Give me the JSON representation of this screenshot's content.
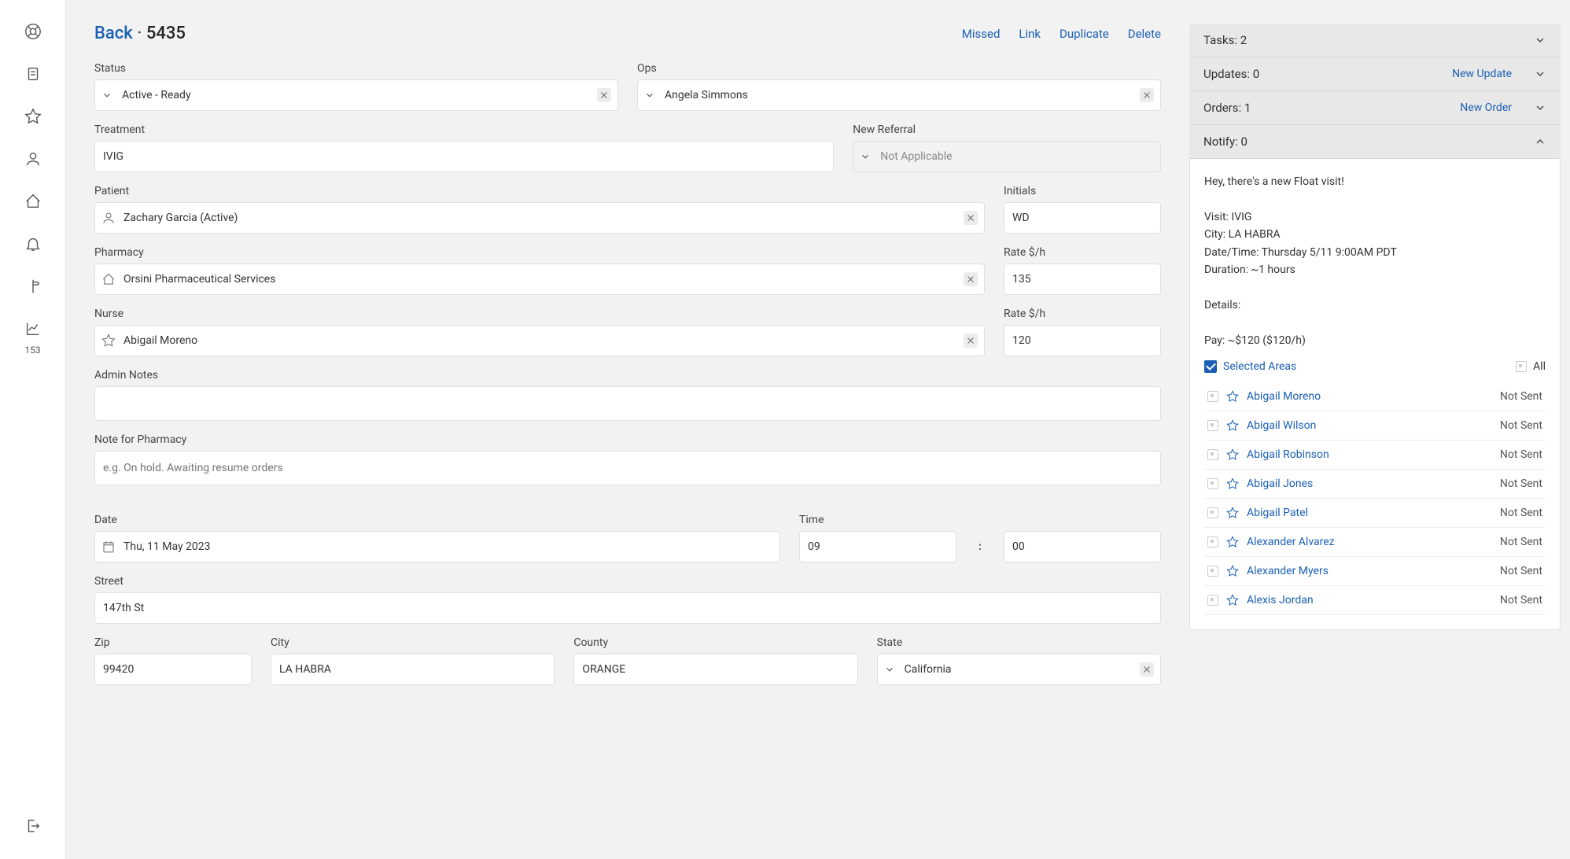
{
  "breadcrumb": {
    "back": "Back",
    "id": "5435"
  },
  "header_actions": {
    "missed": "Missed",
    "link": "Link",
    "duplicate": "Duplicate",
    "delete": "Delete"
  },
  "sidebar": {
    "badge": "153"
  },
  "labels": {
    "status": "Status",
    "ops": "Ops",
    "treatment": "Treatment",
    "new_referral": "New Referral",
    "patient": "Patient",
    "initials": "Initials",
    "pharmacy": "Pharmacy",
    "rate": "Rate $/h",
    "nurse": "Nurse",
    "admin_notes": "Admin Notes",
    "note_pharmacy": "Note for Pharmacy",
    "date": "Date",
    "time": "Time",
    "street": "Street",
    "zip": "Zip",
    "city": "City",
    "county": "County",
    "state": "State"
  },
  "values": {
    "status": "Active - Ready",
    "ops": "Angela Simmons",
    "treatment": "IVIG",
    "new_referral": "Not Applicable",
    "patient": "Zachary Garcia (Active)",
    "initials": "WD",
    "pharmacy": "Orsini Pharmaceutical Services",
    "pharmacy_rate": "135",
    "nurse": "Abigail Moreno",
    "nurse_rate": "120",
    "admin_notes": "",
    "note_pharmacy_placeholder": "e.g. On hold. Awaiting resume orders",
    "date": "Thu, 11 May 2023",
    "time_h": "09",
    "time_m": "00",
    "street": "147th St",
    "zip": "99420",
    "city": "LA HABRA",
    "county": "ORANGE",
    "state": "California"
  },
  "panel": {
    "tasks": "Tasks: 2",
    "updates": "Updates: 0",
    "new_update": "New Update",
    "orders": "Orders: 1",
    "new_order": "New Order",
    "notify": "Notify: 0"
  },
  "notify_message": "Hey, there's a new Float visit!\n\nVisit: IVIG\nCity: LA HABRA\nDate/Time: Thursday 5/11 9:00AM PDT\nDuration: ~1 hours\n\nDetails:\n\nPay: ~$120 ($120/h)",
  "filters": {
    "selected": "Selected Areas",
    "all": "All"
  },
  "nurses": [
    {
      "name": "Abigail Moreno",
      "status": "Not Sent"
    },
    {
      "name": "Abigail Wilson",
      "status": "Not Sent"
    },
    {
      "name": "Abigail Robinson",
      "status": "Not Sent"
    },
    {
      "name": "Abigail Jones",
      "status": "Not Sent"
    },
    {
      "name": "Abigail Patel",
      "status": "Not Sent"
    },
    {
      "name": "Alexander Alvarez",
      "status": "Not Sent"
    },
    {
      "name": "Alexander Myers",
      "status": "Not Sent"
    },
    {
      "name": "Alexis Jordan",
      "status": "Not Sent"
    }
  ]
}
